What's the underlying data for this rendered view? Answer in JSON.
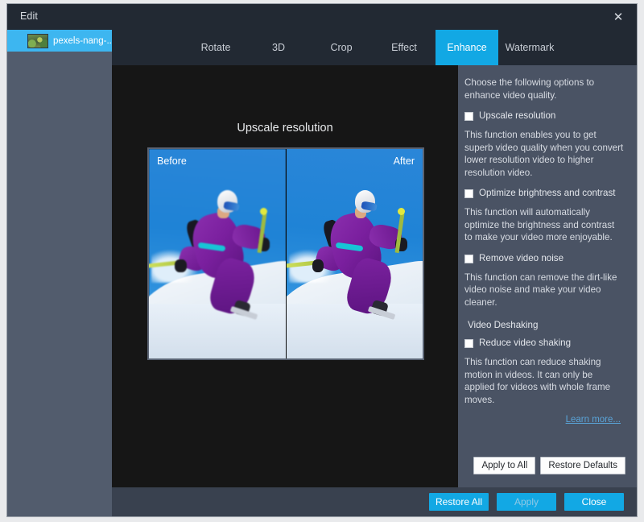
{
  "window": {
    "title": "Edit",
    "close_icon": "close-icon"
  },
  "sidebar": {
    "clips": [
      {
        "label": "pexels-nang-...",
        "thumb": "video-thumbnail"
      }
    ]
  },
  "tabs": [
    {
      "label": "Rotate",
      "active": false
    },
    {
      "label": "3D",
      "active": false
    },
    {
      "label": "Crop",
      "active": false
    },
    {
      "label": "Effect",
      "active": false
    },
    {
      "label": "Enhance",
      "active": true
    },
    {
      "label": "Watermark",
      "active": false
    }
  ],
  "preview": {
    "title": "Upscale resolution",
    "before_label": "Before",
    "after_label": "After"
  },
  "panel": {
    "intro": "Choose the following options to enhance video quality.",
    "options": [
      {
        "label": "Upscale resolution",
        "checked": false,
        "description": "This function enables you to get superb video quality when you convert lower resolution video to higher resolution video."
      },
      {
        "label": "Optimize brightness and contrast",
        "checked": false,
        "description": "This function will automatically optimize the brightness and contrast to make your video more enjoyable."
      },
      {
        "label": "Remove video noise",
        "checked": false,
        "description": "This function can remove the dirt-like video noise and make your video cleaner."
      }
    ],
    "group_label": "Video Deshaking",
    "deshake": {
      "label": "Reduce video shaking",
      "checked": false,
      "description": "This function can reduce shaking motion in videos. It can only be applied for videos with whole frame moves."
    },
    "learn_more": "Learn more...",
    "apply_to_all": "Apply to All",
    "restore_defaults": "Restore Defaults"
  },
  "footer": {
    "restore_all": "Restore All",
    "apply": "Apply",
    "apply_disabled": true,
    "close": "Close"
  },
  "colors": {
    "accent": "#12a8e4",
    "panel_bg": "#4a5364",
    "titlebar_bg": "#222933",
    "canvas_bg": "#161616",
    "sidebar_bg": "#525c6d",
    "link": "#5aa4d8"
  }
}
